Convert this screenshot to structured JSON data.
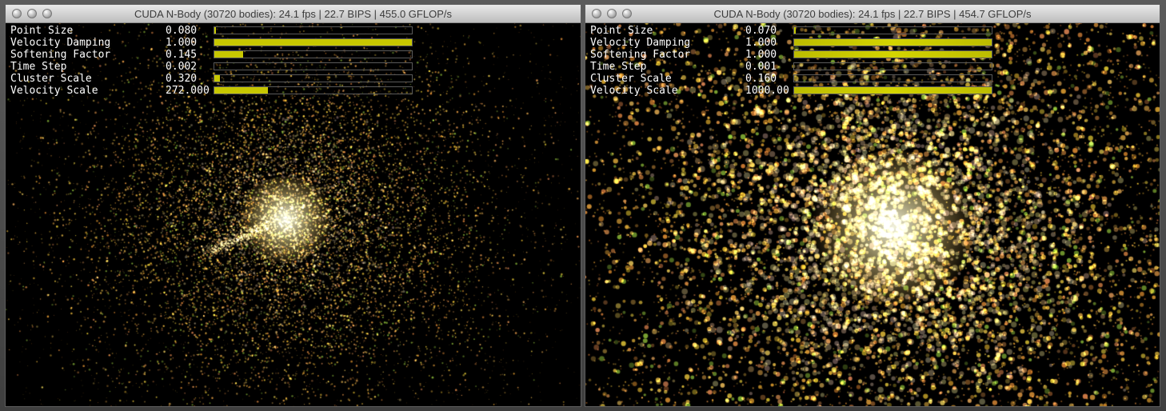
{
  "windows": [
    {
      "title": "CUDA N-Body (30720 bodies): 24.1 fps | 22.7 BIPS | 455.0 GFLOP/s",
      "params": [
        {
          "label": "Point Size",
          "value": "0.080",
          "fill": 0.01
        },
        {
          "label": "Velocity Damping",
          "value": "1.000",
          "fill": 1.0
        },
        {
          "label": "Softening Factor",
          "value": "0.145",
          "fill": 0.145
        },
        {
          "label": "Time Step",
          "value": "0.002",
          "fill": 0.0
        },
        {
          "label": "Cluster Scale",
          "value": "0.320",
          "fill": 0.03
        },
        {
          "label": "Velocity Scale",
          "value": "272.000",
          "fill": 0.272
        }
      ]
    },
    {
      "title": "CUDA N-Body (30720 bodies): 24.1 fps | 22.7 BIPS | 454.7 GFLOP/s",
      "params": [
        {
          "label": "Point Size",
          "value": "0.070",
          "fill": 0.01
        },
        {
          "label": "Velocity Damping",
          "value": "1.000",
          "fill": 1.0
        },
        {
          "label": "Softening Factor",
          "value": "1.000",
          "fill": 1.0
        },
        {
          "label": "Time Step",
          "value": "0.001",
          "fill": 0.0
        },
        {
          "label": "Cluster Scale",
          "value": "0.160",
          "fill": 0.0
        },
        {
          "label": "Velocity Scale",
          "value": "1000.00",
          "fill": 1.0
        }
      ]
    }
  ]
}
